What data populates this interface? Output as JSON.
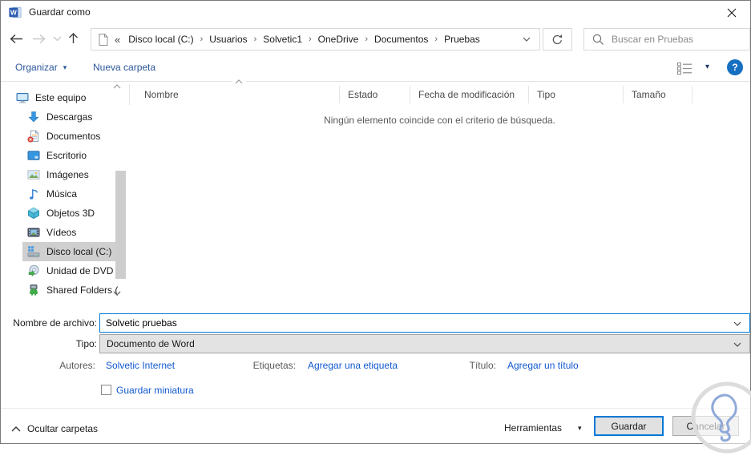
{
  "window": {
    "title": "Guardar como"
  },
  "nav": {
    "breadcrumb_overflow": "«",
    "breadcrumb": [
      "Disco local (C:)",
      "Usuarios",
      "Solvetic1",
      "OneDrive",
      "Documentos",
      "Pruebas"
    ],
    "search_placeholder": "Buscar en Pruebas"
  },
  "toolbar": {
    "organize_label": "Organizar",
    "new_folder_label": "Nueva carpeta",
    "help_label": "?"
  },
  "sidebar": {
    "items": [
      {
        "key": "este-equipo",
        "label": "Este equipo",
        "icon": "computer-icon",
        "level": 0,
        "selected": false
      },
      {
        "key": "descargas",
        "label": "Descargas",
        "icon": "downloads-icon",
        "level": 1,
        "selected": false
      },
      {
        "key": "documentos",
        "label": "Documentos",
        "icon": "documents-icon",
        "level": 1,
        "selected": false
      },
      {
        "key": "escritorio",
        "label": "Escritorio",
        "icon": "desktop-icon",
        "level": 1,
        "selected": false
      },
      {
        "key": "imagenes",
        "label": "Imágenes",
        "icon": "pictures-icon",
        "level": 1,
        "selected": false
      },
      {
        "key": "musica",
        "label": "Música",
        "icon": "music-icon",
        "level": 1,
        "selected": false
      },
      {
        "key": "objetos-3d",
        "label": "Objetos 3D",
        "icon": "objects-3d-icon",
        "level": 1,
        "selected": false
      },
      {
        "key": "videos",
        "label": "Vídeos",
        "icon": "videos-icon",
        "level": 1,
        "selected": false
      },
      {
        "key": "disco-local-c",
        "label": "Disco local (C:)",
        "icon": "local-disk-icon",
        "level": 1,
        "selected": true
      },
      {
        "key": "unidad-dvd",
        "label": "Unidad de DVD (",
        "icon": "dvd-icon",
        "level": 1,
        "selected": false
      },
      {
        "key": "shared-folders",
        "label": "Shared Folders (",
        "icon": "shared-folders-icon",
        "level": 1,
        "selected": false
      }
    ]
  },
  "list": {
    "columns": [
      "Nombre",
      "Estado",
      "Fecha de modificación",
      "Tipo",
      "Tamaño"
    ],
    "empty_message": "Ningún elemento coincide con el criterio de búsqueda."
  },
  "form": {
    "filename_label": "Nombre de archivo:",
    "filename_value": "Solvetic pruebas",
    "type_label": "Tipo:",
    "type_value": "Documento de Word",
    "authors_label": "Autores:",
    "authors_value": "Solvetic Internet",
    "tags_label": "Etiquetas:",
    "tags_value": "Agregar una etiqueta",
    "title_label": "Título:",
    "title_value": "Agregar un título",
    "thumbnail_label": "Guardar miniatura",
    "thumbnail_checked": false
  },
  "footer": {
    "hide_folders_label": "Ocultar carpetas",
    "tools_label": "Herramientas",
    "save_label": "Guardar",
    "cancel_label": "Cancelar"
  },
  "colors": {
    "accent": "#0078d7",
    "link": "#1158d0",
    "command_link": "#2b579a",
    "selection": "#cfcfcf",
    "help_button": "#176fc1"
  }
}
